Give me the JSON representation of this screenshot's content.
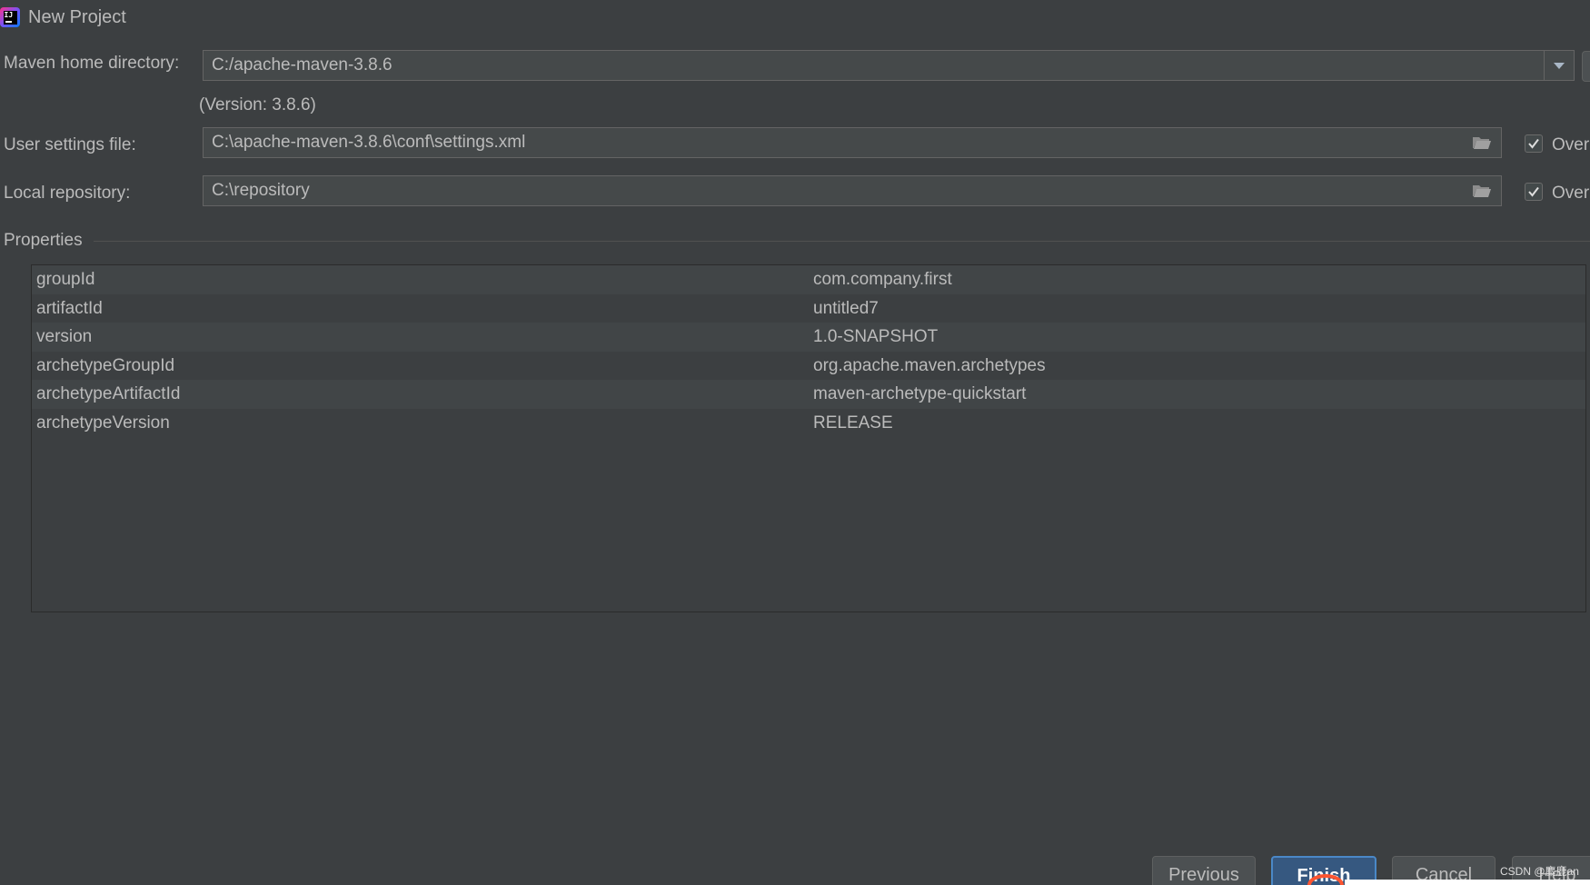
{
  "window": {
    "title": "New Project",
    "app_icon": "intellij-idea-icon"
  },
  "form": {
    "maven_home": {
      "label": "Maven home directory:",
      "value": "C:/apache-maven-3.8.6",
      "version_note": "(Version: 3.8.6)"
    },
    "user_settings": {
      "label": "User settings file:",
      "value": "C:\\apache-maven-3.8.6\\conf\\settings.xml",
      "override_label": "Override",
      "override_checked": true
    },
    "local_repo": {
      "label": "Local repository:",
      "value": "C:\\repository",
      "override_label": "Override",
      "override_checked": true
    }
  },
  "properties": {
    "title": "Properties",
    "rows": [
      {
        "key": "groupId",
        "value": "com.company.first"
      },
      {
        "key": "artifactId",
        "value": "untitled7"
      },
      {
        "key": "version",
        "value": "1.0-SNAPSHOT"
      },
      {
        "key": "archetypeGroupId",
        "value": "org.apache.maven.archetypes"
      },
      {
        "key": "archetypeArtifactId",
        "value": "maven-archetype-quickstart"
      },
      {
        "key": "archetypeVersion",
        "value": "RELEASE"
      }
    ]
  },
  "buttons": {
    "previous": "Previous",
    "finish": "Finish",
    "cancel": "Cancel",
    "help": "Help"
  },
  "watermark": "CSDN @麋鹿an",
  "colors": {
    "background": "#3c3f41",
    "field_background": "#45494a",
    "accent": "#365880",
    "text": "#bbbbbb"
  }
}
